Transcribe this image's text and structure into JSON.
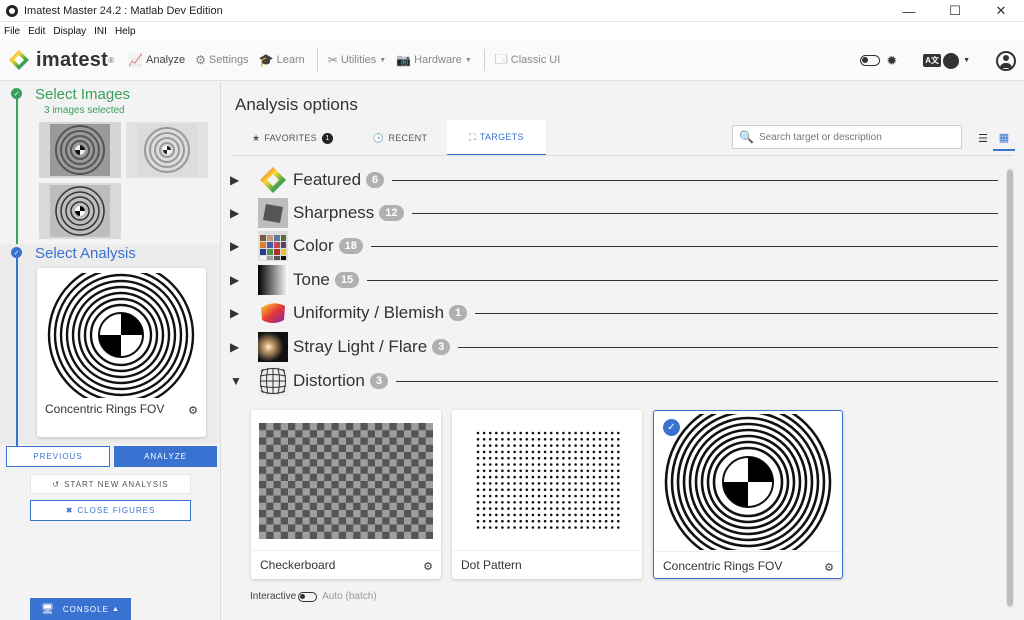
{
  "window": {
    "title": "Imatest Master 24.2 : Matlab Dev Edition",
    "minimize": "—",
    "maximize": "☐",
    "close": "✕"
  },
  "menu": [
    "File",
    "Edit",
    "Display",
    "INI",
    "Help"
  ],
  "toolbar": {
    "logo_text": "imatest",
    "logo_reg": "®",
    "analyze": "Analyze",
    "settings": "Settings",
    "learn": "Learn",
    "utilities": "Utilities",
    "hardware": "Hardware",
    "classic_ui": "Classic UI",
    "lang_badge": "A文"
  },
  "sidebar": {
    "step1_title": "Select Images",
    "step1_sub": "3 images selected",
    "step2_title": "Select Analysis",
    "analysis_label": "Concentric Rings FOV",
    "previous": "PREVIOUS",
    "analyze": "ANALYZE",
    "start_new": "START NEW ANALYSIS",
    "close_figures": "CLOSE FIGURES",
    "console": "CONSOLE"
  },
  "main": {
    "title": "Analysis options",
    "tabs": [
      {
        "label": "FAVORITES",
        "badge": "1"
      },
      {
        "label": "RECENT"
      },
      {
        "label": "TARGETS"
      }
    ],
    "search_placeholder": "Search target or description",
    "categories": [
      {
        "name": "Featured",
        "count": "6",
        "expanded": false
      },
      {
        "name": "Sharpness",
        "count": "12",
        "expanded": false
      },
      {
        "name": "Color",
        "count": "18",
        "expanded": false
      },
      {
        "name": "Tone",
        "count": "15",
        "expanded": false
      },
      {
        "name": "Uniformity / Blemish",
        "count": "1",
        "expanded": false
      },
      {
        "name": "Stray Light / Flare",
        "count": "3",
        "expanded": false
      },
      {
        "name": "Distortion",
        "count": "3",
        "expanded": true
      }
    ],
    "targets": [
      {
        "label": "Checkerboard",
        "selected": false
      },
      {
        "label": "Dot Pattern",
        "selected": false
      },
      {
        "label": "Concentric Rings FOV",
        "selected": true
      }
    ],
    "interactive_label": "Interactive",
    "auto_label": "Auto (batch)"
  },
  "colors": {
    "accent": "#3a72d1",
    "step_done": "#3aa05a",
    "badge": "#b0b0b0"
  }
}
